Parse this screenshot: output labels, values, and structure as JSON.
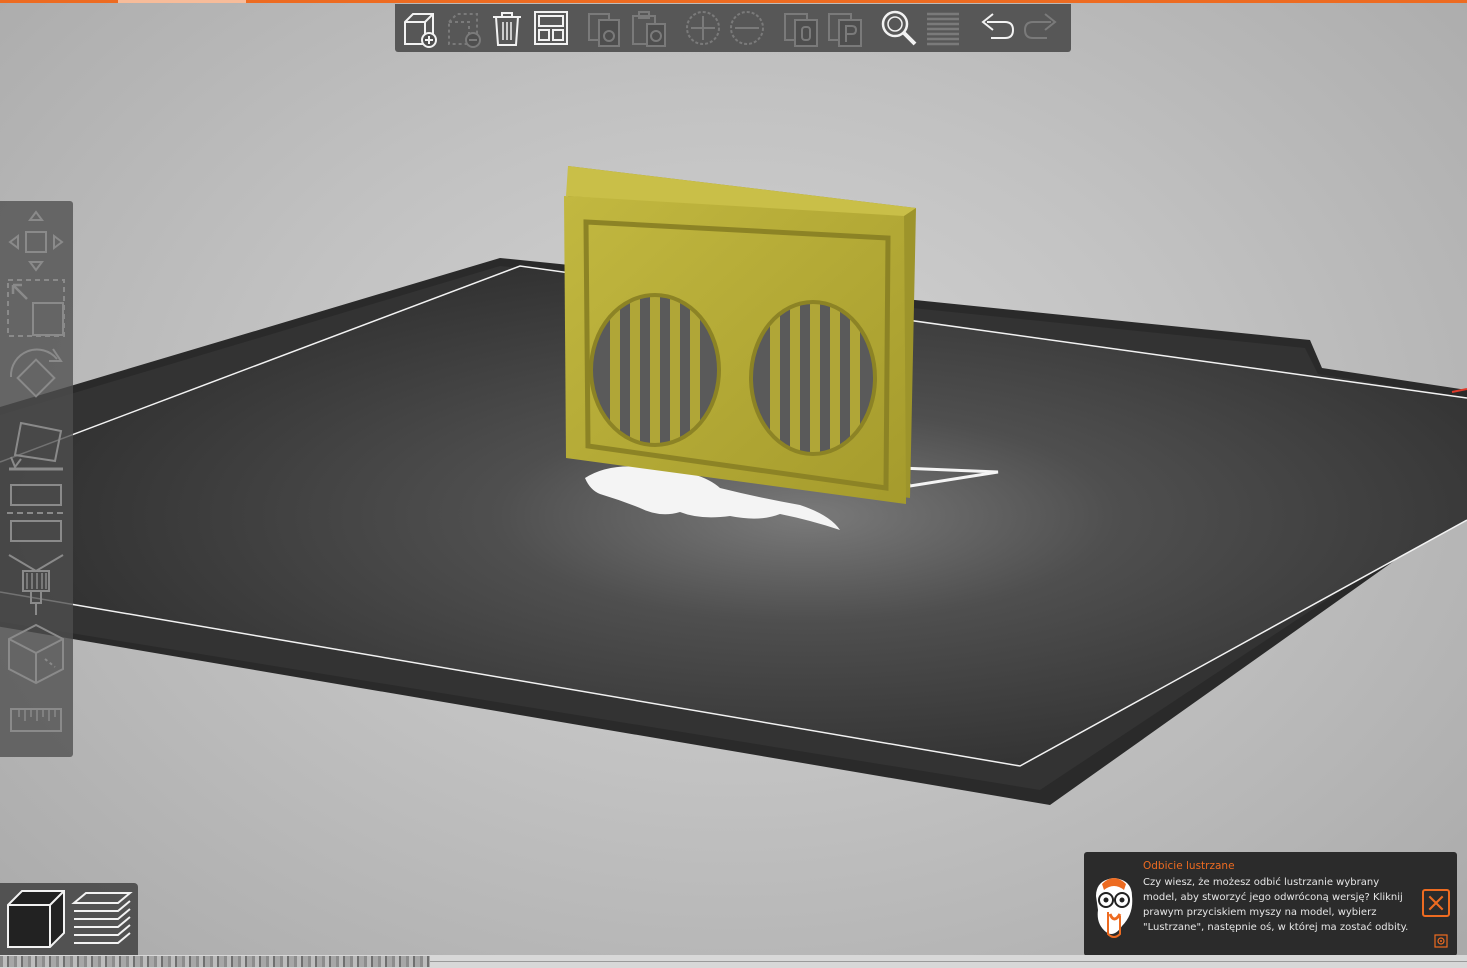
{
  "app": {
    "accent_color": "#ed6b21"
  },
  "top_toolbar": {
    "buttons": [
      {
        "icon": "add-object-icon",
        "label": "Add",
        "enabled": true
      },
      {
        "icon": "remove-object-icon",
        "label": "Delete",
        "enabled": false
      },
      {
        "icon": "delete-all-icon",
        "label": "Delete all",
        "enabled": true
      },
      {
        "icon": "arrange-icon",
        "label": "Arrange",
        "enabled": true
      },
      {
        "icon": "copy-icon",
        "label": "Copy",
        "enabled": false
      },
      {
        "icon": "paste-icon",
        "label": "Paste",
        "enabled": false
      },
      {
        "icon": "add-instance-icon",
        "label": "Add instance",
        "enabled": false
      },
      {
        "icon": "remove-instance-icon",
        "label": "Remove instance",
        "enabled": false
      },
      {
        "icon": "split-objects-icon",
        "label": "Split to objects",
        "enabled": false
      },
      {
        "icon": "split-parts-icon",
        "label": "Split to parts",
        "enabled": false
      },
      {
        "icon": "search-icon",
        "label": "Search",
        "enabled": true
      },
      {
        "icon": "layers-editing-icon",
        "label": "Variable layer height",
        "enabled": false
      },
      {
        "icon": "undo-icon",
        "label": "Undo",
        "enabled": true
      },
      {
        "icon": "redo-icon",
        "label": "Redo",
        "enabled": false
      }
    ]
  },
  "left_toolbar": {
    "tools": [
      {
        "icon": "move-icon"
      },
      {
        "icon": "scale-icon"
      },
      {
        "icon": "rotate-icon"
      },
      {
        "icon": "place-on-face-icon"
      },
      {
        "icon": "cut-icon"
      },
      {
        "icon": "paint-supports-icon"
      },
      {
        "icon": "seam-painting-icon"
      },
      {
        "icon": "measure-icon"
      }
    ]
  },
  "view_switch": {
    "buttons": [
      {
        "icon": "3d-view-icon",
        "active": true
      },
      {
        "icon": "preview-layers-icon",
        "active": false
      }
    ]
  },
  "hint": {
    "title": "Odbicie lustrzane",
    "text": "Czy wiesz, że możesz odbić lustrzanie wybrany model, aby stworzyć jego odwróconą wersję? Kliknij prawym przyciskiem myszy na model, wybierz \"Lustrzane\", następnie oś, w której ma zostać odbity.",
    "icon": "hint-mascot-icon",
    "close_icon": "close-icon",
    "settings_icon": "gear-icon"
  },
  "scene": {
    "bed_color": "#3a3a3a",
    "model_color": "#b3a935"
  }
}
